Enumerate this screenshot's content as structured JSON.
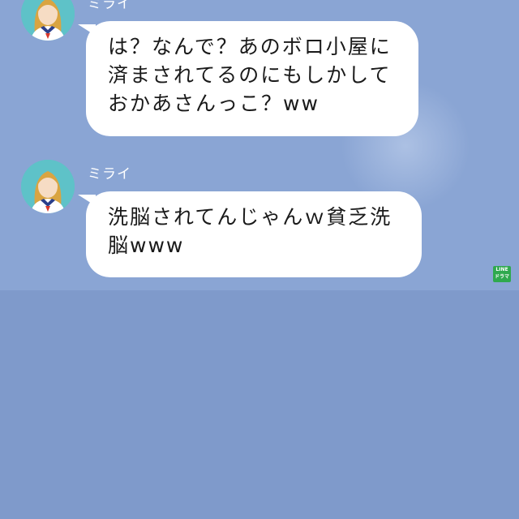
{
  "chat": {
    "messages": [
      {
        "sender": "ミライ",
        "avatar_icon": "girl-avatar-icon",
        "text": "は？なんで？あのボロ小屋に\n済まされてるのにもしかして\nおかあさんっこ？ww"
      },
      {
        "sender": "ミライ",
        "avatar_icon": "girl-avatar-icon",
        "text": "洗脳されてんじゃんｗ貧乏洗\n脳www"
      }
    ]
  },
  "badge": {
    "line1": "LINE",
    "line2": "ドラマ",
    "color": "#2fa94e"
  },
  "colors": {
    "chat_background": "#8aa5d4",
    "page_background": "#7f9acb",
    "bubble": "#ffffff"
  }
}
